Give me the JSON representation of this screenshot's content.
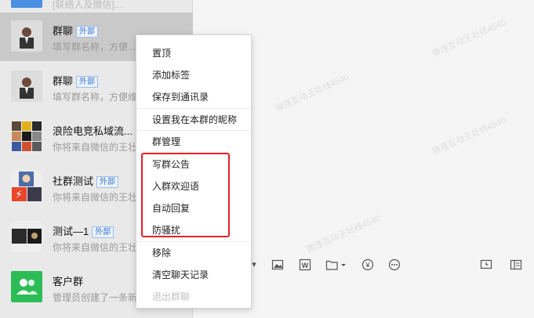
{
  "chat_list": {
    "top_partial": "[联络人及微信]...",
    "items": [
      {
        "name": "群聊",
        "tag": "外部",
        "preview": "填写群名称，方便...",
        "selected": true
      },
      {
        "name": "群聊",
        "tag": "外部",
        "preview": "填写群名称，方便维..."
      },
      {
        "name": "浪险电竞私域流...",
        "tag": "",
        "preview": "你将来自微信的王壮..."
      },
      {
        "name": "社群测试",
        "tag": "外部",
        "preview": "你将来自微信的王壮..."
      },
      {
        "name": "测试—1",
        "tag": "外部",
        "preview": "你将来自微信的王壮..."
      },
      {
        "name": "客户群",
        "tag": "",
        "preview": "管理员创建了一条新..."
      }
    ]
  },
  "context_menu": {
    "items": [
      {
        "label": "置顶"
      },
      {
        "label": "添加标签"
      },
      {
        "label": "保存到通讯录"
      },
      {
        "label": "设置我在本群的昵称"
      },
      {
        "label": "群管理"
      },
      {
        "label": "写群公告"
      },
      {
        "label": "入群欢迎语"
      },
      {
        "label": "自动回复"
      },
      {
        "label": "防骚扰"
      },
      {
        "label": "移除"
      },
      {
        "label": "清空聊天记录"
      },
      {
        "label": "退出群聊",
        "disabled": true
      }
    ]
  },
  "watermark": "微连互动王壮线4540",
  "colors": {
    "highlight": "#e8202a",
    "tag": "#3a78c9",
    "green_avatar": "#2dbd57"
  },
  "icons": [
    "image-icon",
    "word-file-icon",
    "folder-icon",
    "money-icon",
    "more-icon",
    "schedule-icon",
    "sidebar-icon"
  ]
}
